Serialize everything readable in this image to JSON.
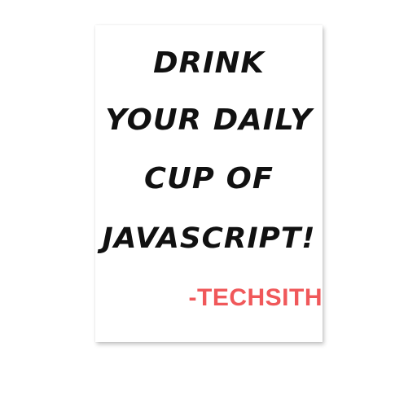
{
  "sticker": {
    "lines": [
      "DRINK",
      "YOUR DAILY",
      "CUP OF",
      "JAVASCRIPT!"
    ],
    "signature": "-TECHSITH"
  },
  "colors": {
    "text": "#111111",
    "signature": "#f0585a",
    "background": "#ffffff"
  }
}
